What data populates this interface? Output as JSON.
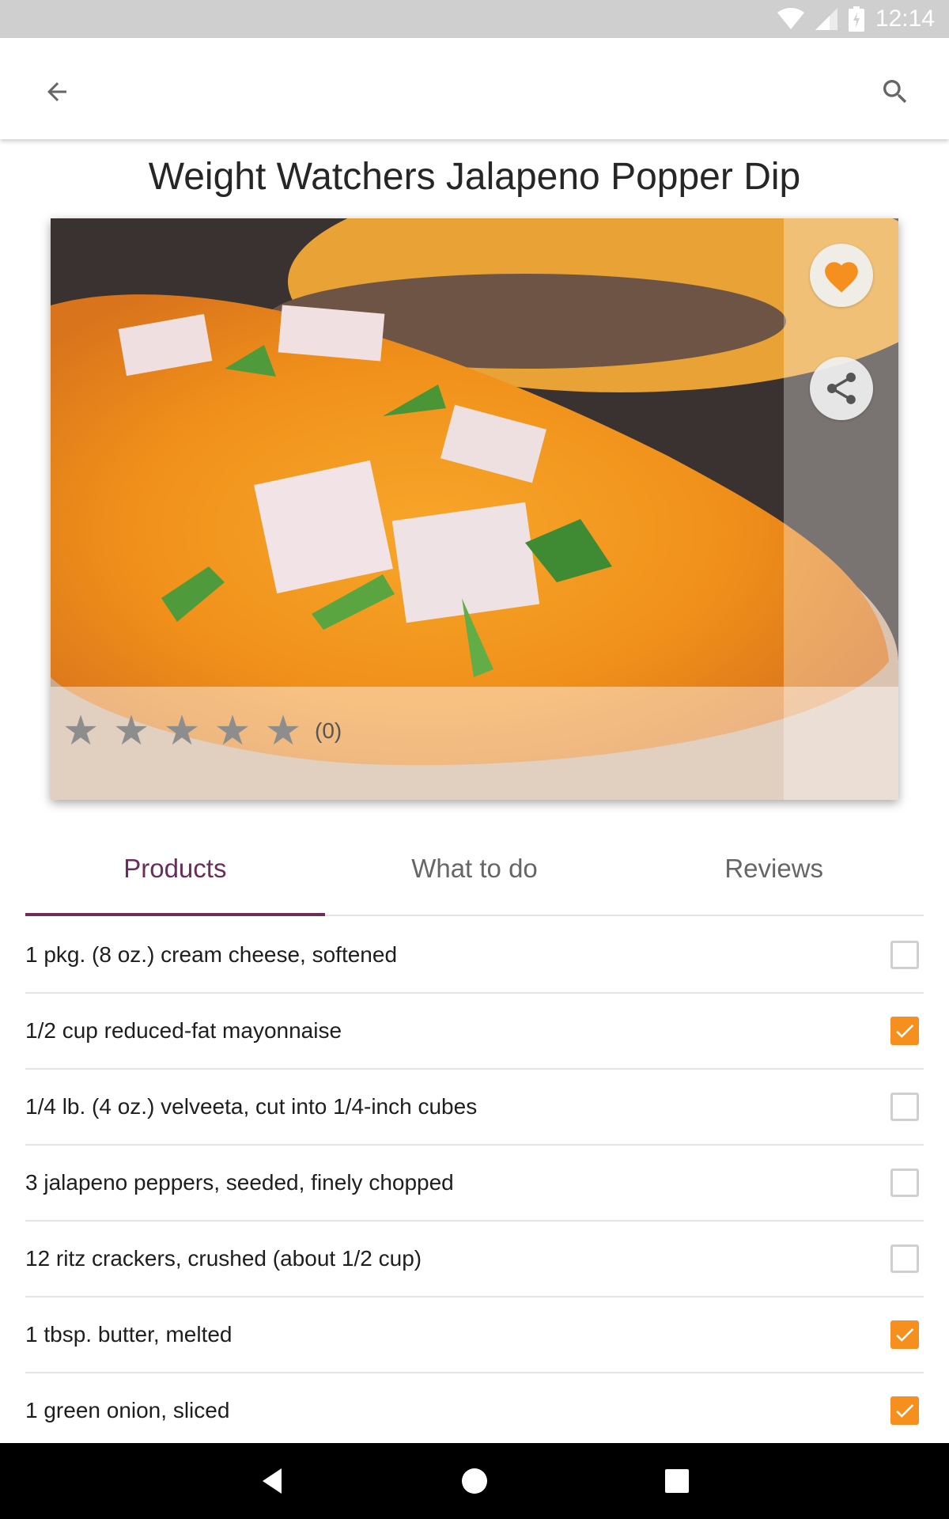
{
  "status_bar": {
    "time": "12:14",
    "icons": [
      "wifi-icon",
      "signal-icon",
      "battery-icon"
    ]
  },
  "app_bar": {
    "back_icon": "arrow-left-icon",
    "search_icon": "search-icon"
  },
  "recipe": {
    "title": "Weight Watchers Jalapeno Popper Dip",
    "rating": {
      "stars": 0,
      "max_stars": 5,
      "count_label": "(0)"
    },
    "favorite_icon": "heart-icon",
    "share_icon": "share-icon"
  },
  "tabs": [
    {
      "label": "Products",
      "active": true
    },
    {
      "label": "What to do",
      "active": false
    },
    {
      "label": "Reviews",
      "active": false
    }
  ],
  "ingredients": [
    {
      "text": "1 pkg. (8 oz.) cream cheese, softened",
      "checked": false
    },
    {
      "text": "1/2 cup reduced-fat mayonnaise",
      "checked": true
    },
    {
      "text": "1/4 lb. (4 oz.) velveeta, cut into 1/4-inch cubes",
      "checked": false
    },
    {
      "text": "3 jalapeno peppers, seeded, finely chopped",
      "checked": false
    },
    {
      "text": "12 ritz crackers, crushed (about 1/2 cup)",
      "checked": false
    },
    {
      "text": "1 tbsp. butter, melted",
      "checked": true
    },
    {
      "text": "1 green onion, sliced",
      "checked": true
    }
  ],
  "colors": {
    "accent": "#6b2d5c",
    "checkbox": "#f5901e",
    "heart": "#f5901e"
  },
  "nav_bar": {
    "icons": [
      "back-triangle-icon",
      "home-circle-icon",
      "recents-square-icon"
    ]
  }
}
